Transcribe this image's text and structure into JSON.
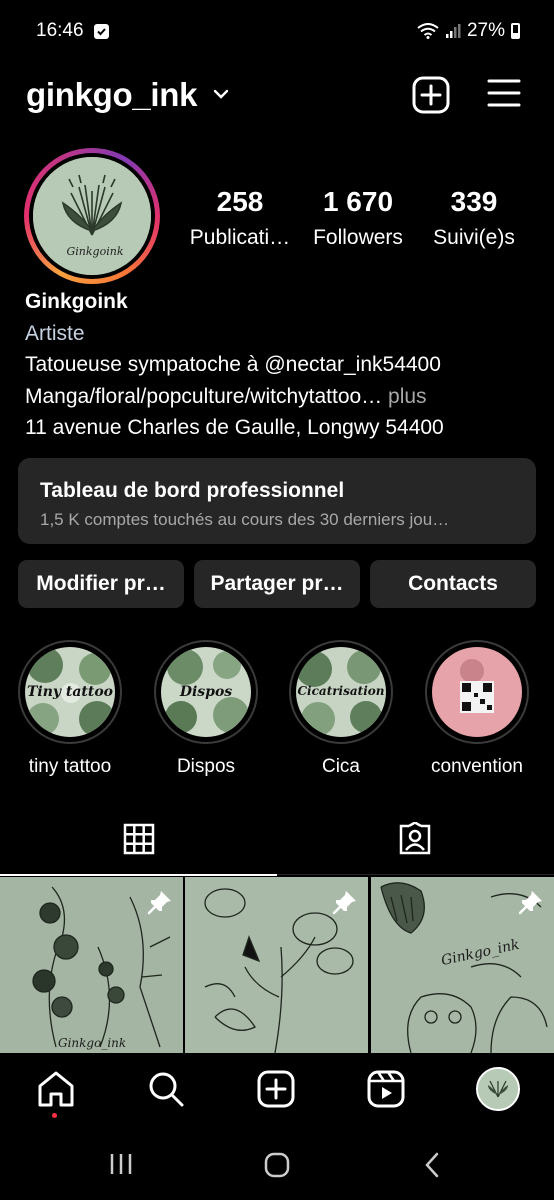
{
  "status_bar": {
    "time": "16:46",
    "battery": "27%"
  },
  "header": {
    "username": "ginkgo_ink"
  },
  "profile": {
    "avatar_text": "Ginkgoink",
    "stats": [
      {
        "value": "258",
        "label": "Publicati…"
      },
      {
        "value": "1 670",
        "label": "Followers"
      },
      {
        "value": "339",
        "label": "Suivi(e)s"
      }
    ],
    "name": "Ginkgoink",
    "category": "Artiste",
    "bio_line1": "Tatoueuse sympatoche à @nectar_ink54400",
    "bio_line2": "Manga/floral/popculture/witchytattoo…",
    "bio_more": " plus",
    "address": "11 avenue Charles de Gaulle, Longwy 54400"
  },
  "dashboard": {
    "title": "Tableau de bord professionnel",
    "subtitle": "1,5 K comptes touchés au cours des 30 derniers jou…"
  },
  "actions": [
    "Modifier pr…",
    "Partager pr…",
    "Contacts"
  ],
  "highlights": [
    {
      "label": "tiny tattoo",
      "overlay": "Tiny tattoo"
    },
    {
      "label": "Dispos",
      "overlay": "Dispos"
    },
    {
      "label": "Cica",
      "overlay": "Cicatrisation"
    },
    {
      "label": "convention",
      "overlay": ""
    }
  ],
  "posts": [
    {
      "watermark": "Ginkgo_ink"
    },
    {
      "watermark": ""
    },
    {
      "watermark": "Ginkgo_ink"
    }
  ],
  "colors": {
    "accent_link": "#c5d2df",
    "muted": "#a8a8a8",
    "card": "#262626",
    "notification": "#ff3040"
  }
}
